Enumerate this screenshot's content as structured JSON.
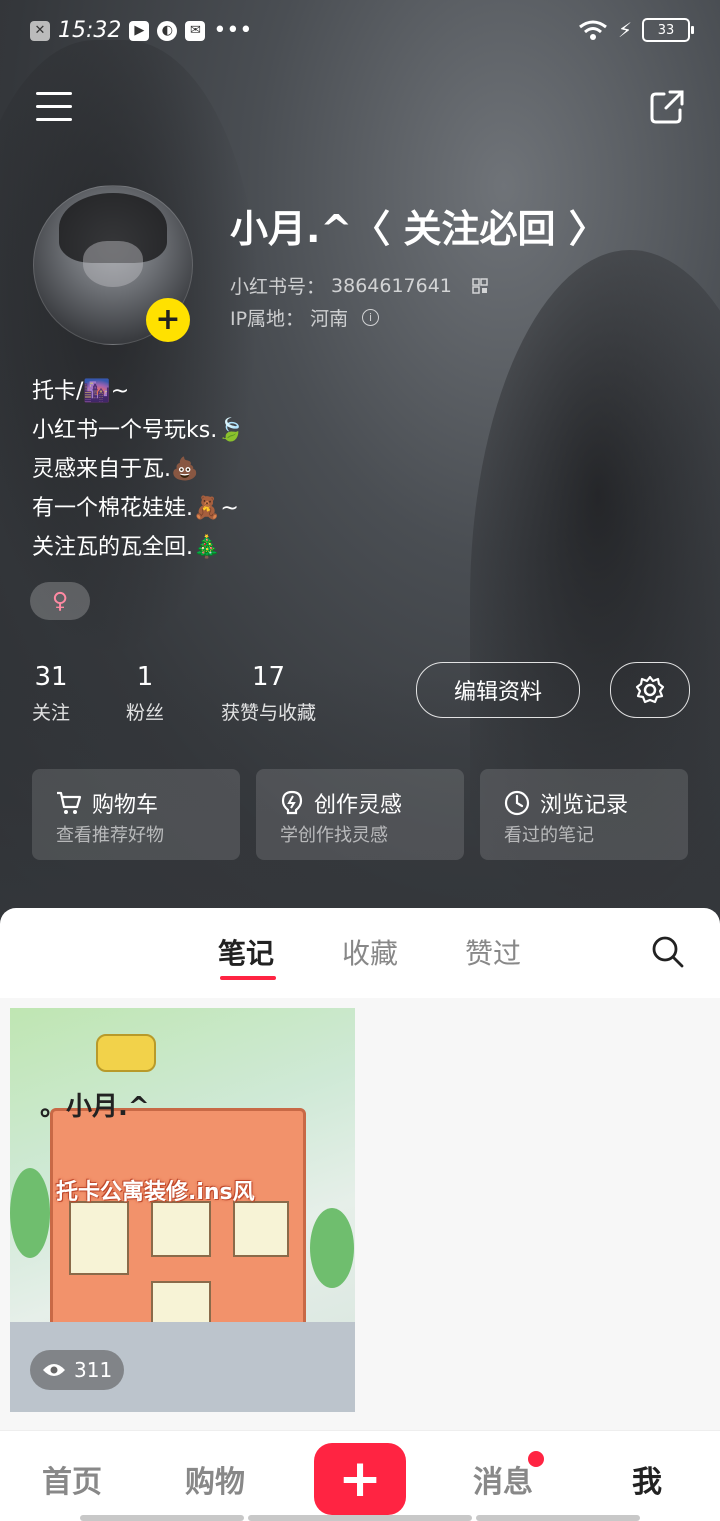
{
  "status": {
    "time": "15:32",
    "battery": "33"
  },
  "profile": {
    "name": "小月.^〈 关注必回 〉",
    "redbook_id_label": "小红书号：",
    "redbook_id": "3864617641",
    "ip_label": "IP属地：",
    "ip": "河南",
    "gender_symbol": "♀",
    "bio": [
      "托卡/🌆~",
      "小红书一个号玩ks.🍃",
      "灵感来自于瓦.💩",
      "有一个棉花娃娃.🧸~",
      "关注瓦的瓦全回.🎄"
    ]
  },
  "stats": [
    {
      "value": "31",
      "label": "关注"
    },
    {
      "value": "1",
      "label": "粉丝"
    },
    {
      "value": "17",
      "label": "获赞与收藏"
    }
  ],
  "actions": {
    "edit_label": "编辑资料"
  },
  "cards": [
    {
      "title": "购物车",
      "subtitle": "查看推荐好物",
      "icon": "cart-icon"
    },
    {
      "title": "创作灵感",
      "subtitle": "学创作找灵感",
      "icon": "bulb-icon"
    },
    {
      "title": "浏览记录",
      "subtitle": "看过的笔记",
      "icon": "clock-icon"
    }
  ],
  "tabs": [
    {
      "label": "笔记",
      "active": true
    },
    {
      "label": "收藏",
      "active": false
    },
    {
      "label": "赞过",
      "active": false
    }
  ],
  "notes": [
    {
      "caption_top": "。小月.^",
      "caption_main": "托卡公寓装修.ins风",
      "views": "311"
    }
  ],
  "bottom_nav": [
    {
      "label": "首页"
    },
    {
      "label": "购物"
    },
    {
      "label": "消息",
      "badge": true
    },
    {
      "label": "我",
      "active": true
    }
  ],
  "colors": {
    "accent": "#ff2442",
    "add_badge": "#ffe100"
  }
}
